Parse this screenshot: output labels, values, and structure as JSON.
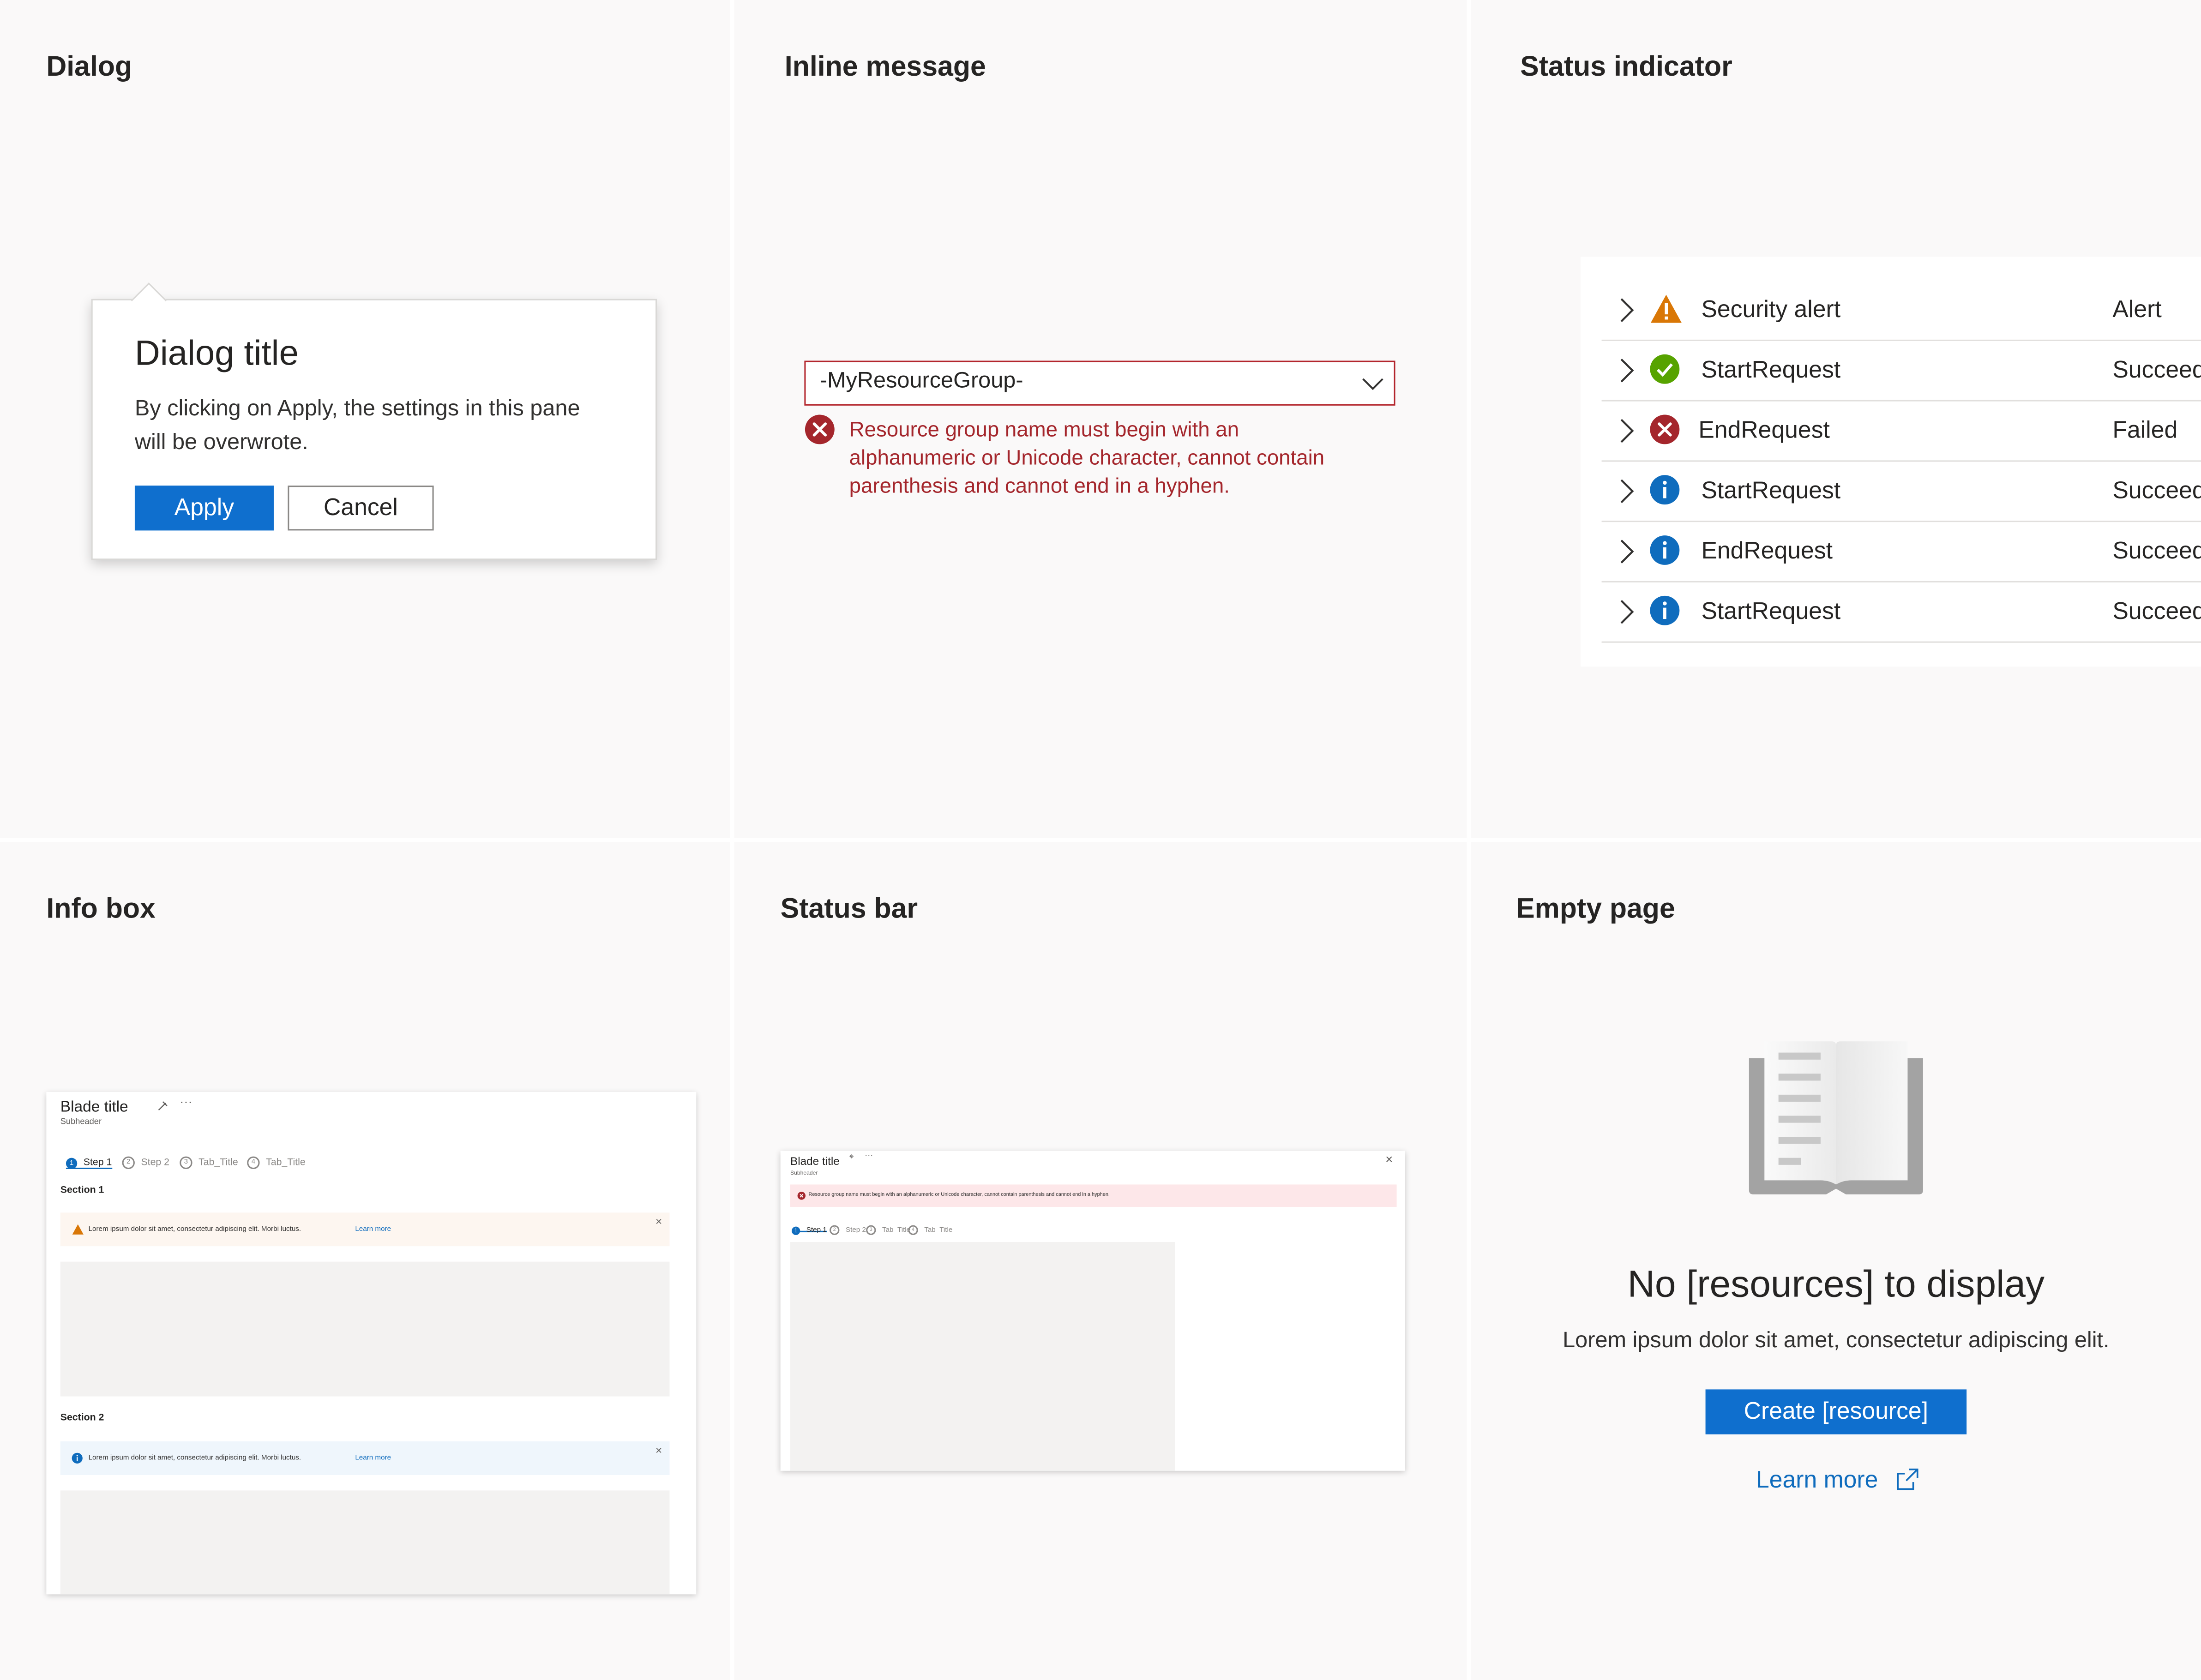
{
  "panels": {
    "dialog": "Dialog",
    "inline_message": "Inline message",
    "status_indicator": "Status indicator",
    "info_box": "Info box",
    "status_bar": "Status bar",
    "empty_page": "Empty page"
  },
  "dialog": {
    "title": "Dialog title",
    "body": "By clicking on Apply, the settings in this pane will be overwrote.",
    "apply_label": "Apply",
    "cancel_label": "Cancel"
  },
  "inline_message": {
    "select_value": "-MyResourceGroup-",
    "error_line1": "Resource group name must begin with an",
    "error_line2": "alphanumeric or Unicode character, cannot contain",
    "error_line3": "parenthesis and cannot end in a hyphen."
  },
  "status_rows": [
    {
      "name": "Security alert",
      "state": "Alert",
      "icon": "warning-icon"
    },
    {
      "name": "StartRequest",
      "state": "Succeed",
      "icon": "success-icon"
    },
    {
      "name": "EndRequest",
      "state": "Failed",
      "icon": "error-icon"
    },
    {
      "name": "StartRequest",
      "state": "Succeed",
      "icon": "info-icon"
    },
    {
      "name": "EndRequest",
      "state": "Succeed",
      "icon": "info-icon"
    },
    {
      "name": "StartRequest",
      "state": "Succeed",
      "icon": "info-icon"
    }
  ],
  "info_blade": {
    "title": "Blade title",
    "subheader": "Subheader",
    "tabs": [
      "Step 1",
      "Step 2",
      "Tab_Title",
      "Tab_Title"
    ],
    "tab_numbers": [
      "1",
      "2",
      "3",
      "4"
    ],
    "section1": "Section 1",
    "section2": "Section 2",
    "warning_text": "Lorem ipsum dolor sit amet, consectetur adipiscing elit. Morbi luctus.",
    "info_text": "Lorem ipsum dolor sit amet, consectetur adipiscing elit. Morbi luctus.",
    "learn_more": "Learn more"
  },
  "status_blade": {
    "title": "Blade title",
    "subheader": "Subheader",
    "error_text": "Resource group name must begin with an alphanumeric or Unicode character, cannot contain parenthesis and cannot end in a hyphen.",
    "tabs": [
      "Step 1",
      "Step 2",
      "Tab_Title",
      "Tab_Title"
    ],
    "tab_numbers": [
      "1",
      "2",
      "3",
      "4"
    ]
  },
  "empty_page": {
    "title": "No [resources] to display",
    "subtitle": "Lorem ipsum dolor sit amet, consectetur adipiscing elit.",
    "create_label": "Create [resource]",
    "learn_more": "Learn more"
  },
  "colors": {
    "primary": "#0f6fce",
    "error": "#a4262c",
    "warning": "#d97706",
    "success": "#57a300",
    "info": "#0f6cbd"
  }
}
